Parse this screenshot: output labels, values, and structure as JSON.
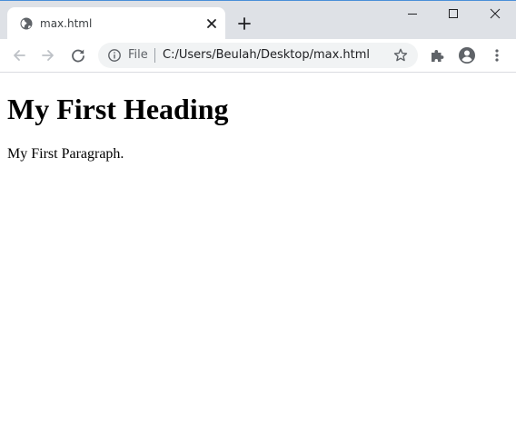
{
  "tab": {
    "title": "max.html",
    "favicon": "globe-icon",
    "close_icon": "close-icon"
  },
  "tabstrip": {
    "new_tab_icon": "plus-icon"
  },
  "window_controls": {
    "minimize_icon": "minimize-icon",
    "maximize_icon": "maximize-icon",
    "close_icon": "close-icon"
  },
  "toolbar": {
    "back_icon": "back-arrow-icon",
    "forward_icon": "forward-arrow-icon",
    "reload_icon": "reload-icon",
    "extensions_icon": "puzzle-icon",
    "profile_icon": "account-icon",
    "menu_icon": "kebab-menu-icon"
  },
  "omnibox": {
    "security_icon": "info-icon",
    "scheme_label": "File",
    "url": "C:/Users/Beulah/Desktop/max.html",
    "bookmark_icon": "star-icon"
  },
  "page": {
    "heading": "My First Heading",
    "paragraph": "My First Paragraph."
  },
  "colors": {
    "tabstrip_bg": "#dee1e6",
    "omnibox_bg": "#f1f3f4",
    "icon_color": "#5f6368",
    "disabled_icon_color": "#bdc1c6"
  }
}
